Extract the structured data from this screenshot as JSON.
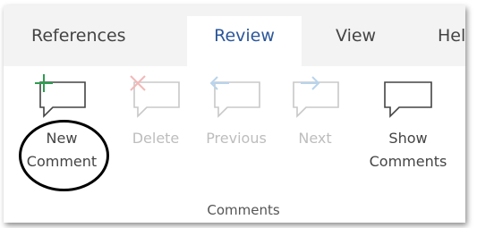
{
  "tabs": {
    "references": "References",
    "review": "Review",
    "view": "View",
    "help": "Hel"
  },
  "commands": {
    "new_comment": {
      "line1": "New",
      "line2": "Comment",
      "icon": "new-comment-icon",
      "enabled": true
    },
    "delete": {
      "label": "Delete",
      "icon": "delete-comment-icon",
      "enabled": false
    },
    "previous": {
      "label": "Previous",
      "icon": "previous-comment-icon",
      "enabled": false
    },
    "next": {
      "label": "Next",
      "icon": "next-comment-icon",
      "enabled": false
    },
    "show_comments": {
      "line1": "Show",
      "line2": "Comments",
      "icon": "show-comments-icon",
      "enabled": true
    }
  },
  "group_label": "Comments",
  "colors": {
    "active_tab_text": "#2b579a",
    "tab_bar_bg": "#f3f3f3",
    "new_comment_plus": "#2e9e4f",
    "disabled_text": "#bdbdbd",
    "highlight_circle": "#000000"
  }
}
